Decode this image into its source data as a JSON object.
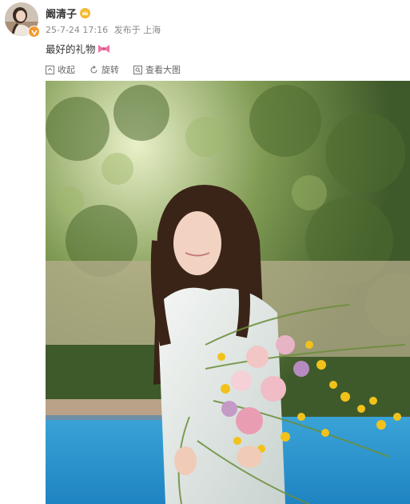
{
  "post": {
    "username": "阚清子",
    "timestamp": "25-7-24 17:16",
    "source": "发布于 上海",
    "text": "最好的礼物",
    "emoji_icon": "pink-bow-icon",
    "verified_badge_color": "#f29a2e",
    "member_icon": "crown-icon"
  },
  "toolbar": {
    "collapse_label": "收起",
    "rotate_label": "旋转",
    "view_large_label": "查看大图"
  },
  "photo": {
    "subject": "woman-holding-bouquet"
  }
}
